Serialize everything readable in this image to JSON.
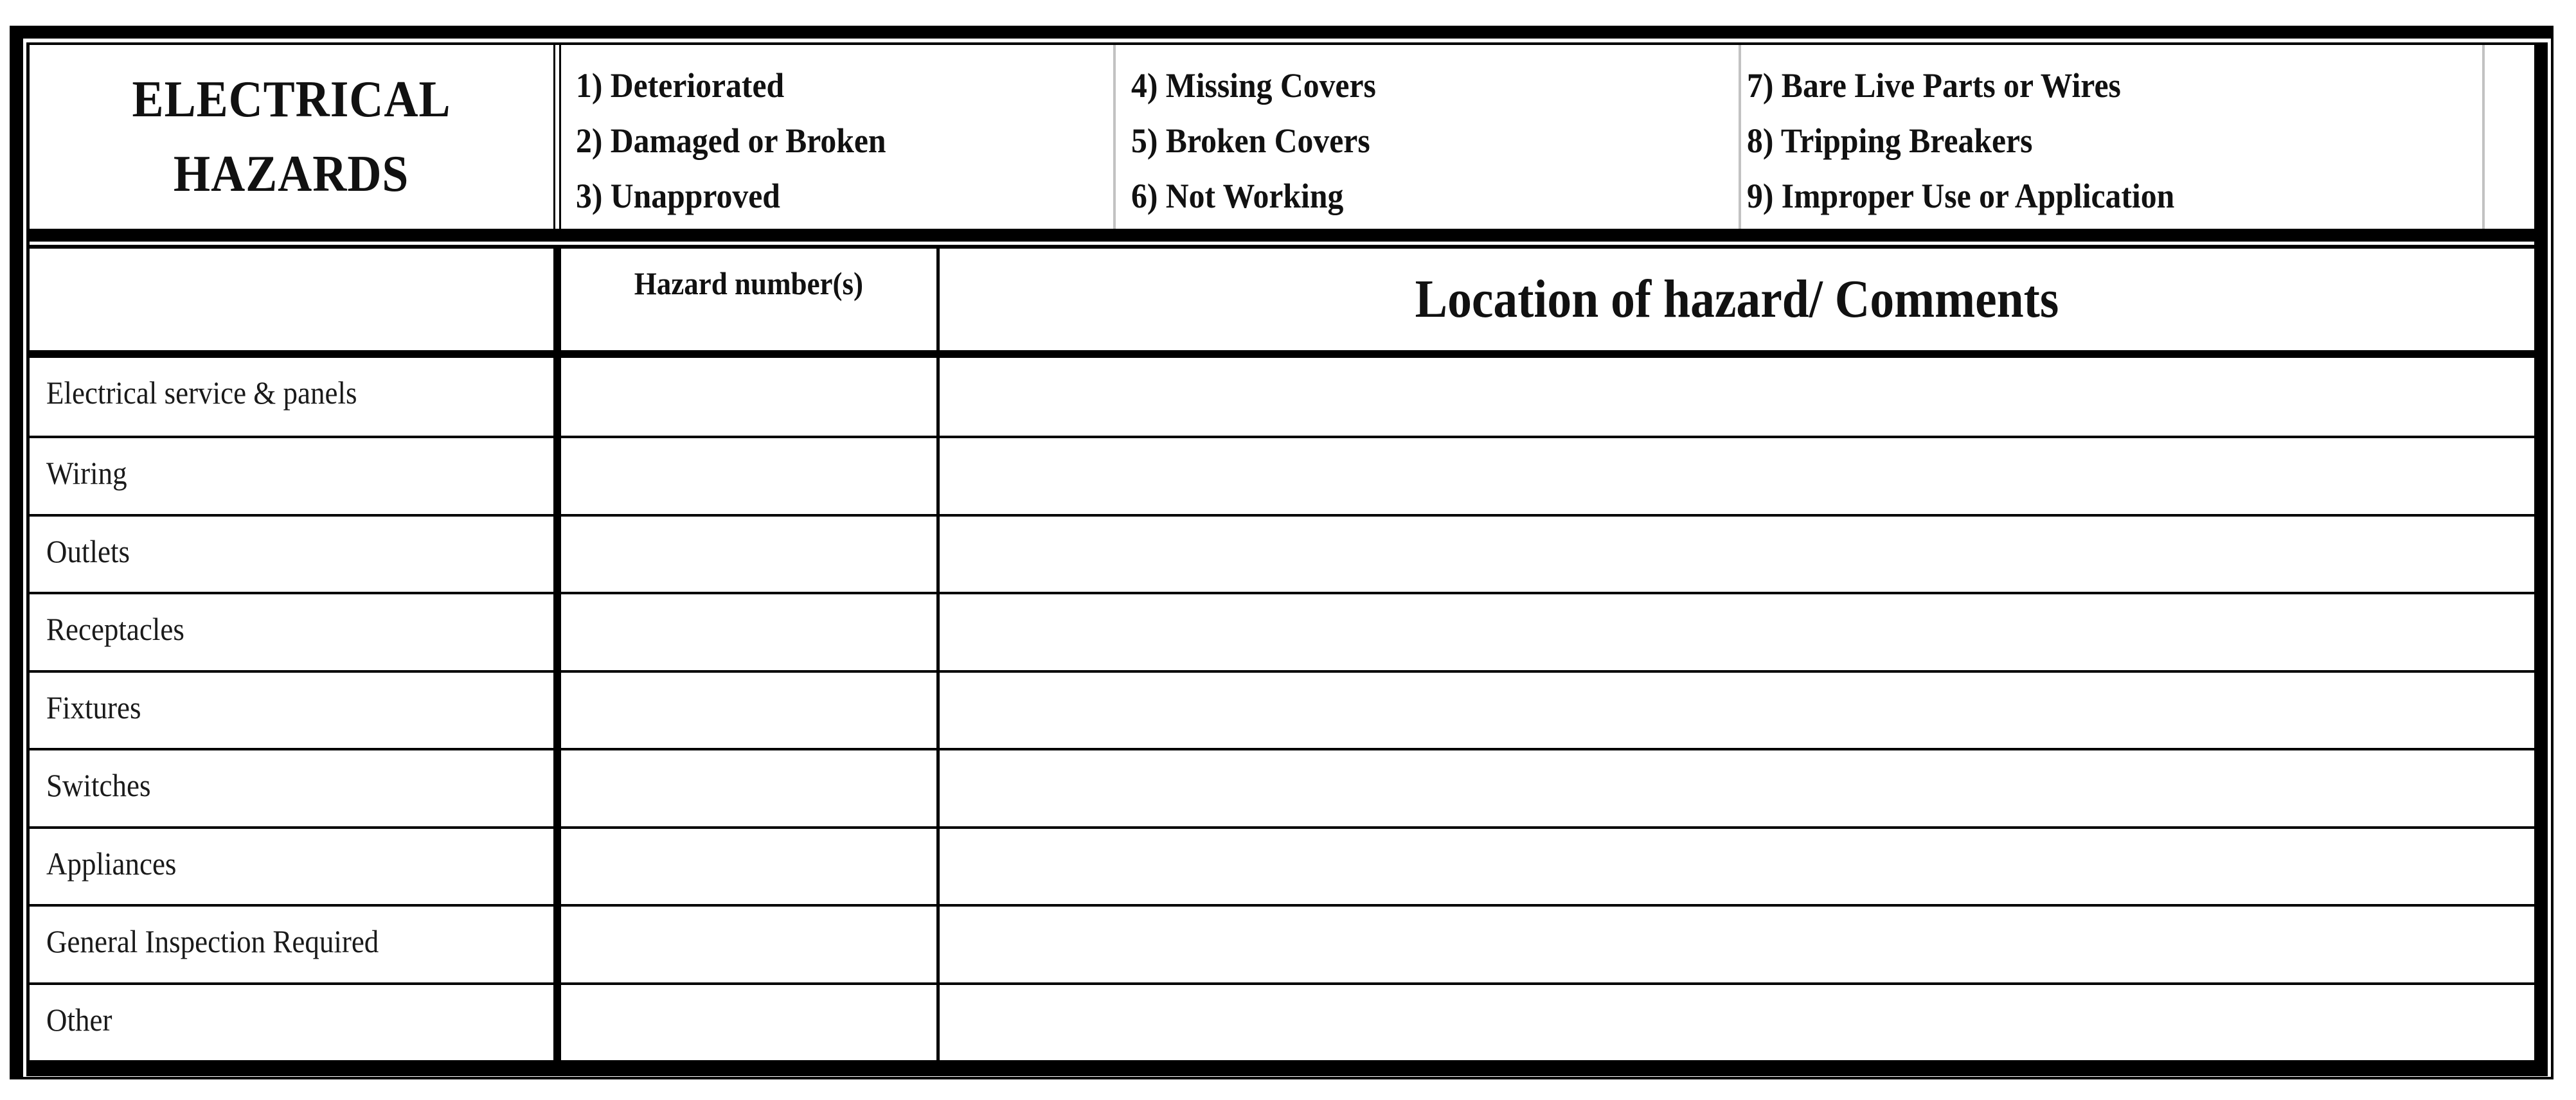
{
  "form": {
    "title_lines": [
      "ELECTRICAL",
      "HAZARDS"
    ],
    "legend": {
      "columns": [
        [
          "1) Deteriorated",
          "2) Damaged or Broken",
          "3) Unapproved"
        ],
        [
          "4) Missing Covers",
          "5) Broken Covers",
          "6) Not Working"
        ],
        [
          "7) Bare Live Parts or Wires",
          "8) Tripping Breakers",
          "9) Improper Use or Application"
        ]
      ]
    },
    "table": {
      "headers": {
        "category": "",
        "hazard_numbers": "Hazard number(s)",
        "location_comments": "Location of hazard/ Comments"
      },
      "rows": [
        {
          "label": "Electrical service & panels",
          "hazard_numbers": "",
          "comments": ""
        },
        {
          "label": "Wiring",
          "hazard_numbers": "",
          "comments": ""
        },
        {
          "label": "Outlets",
          "hazard_numbers": "",
          "comments": ""
        },
        {
          "label": "Receptacles",
          "hazard_numbers": "",
          "comments": ""
        },
        {
          "label": "Fixtures",
          "hazard_numbers": "",
          "comments": ""
        },
        {
          "label": "Switches",
          "hazard_numbers": "",
          "comments": ""
        },
        {
          "label": "Appliances",
          "hazard_numbers": "",
          "comments": ""
        },
        {
          "label": "General Inspection Required",
          "hazard_numbers": "",
          "comments": ""
        },
        {
          "label": "Other",
          "hazard_numbers": "",
          "comments": ""
        }
      ]
    },
    "colors": {
      "border": "#000000",
      "legend_divider": "#c2c2c2",
      "background": "#ffffff"
    }
  }
}
